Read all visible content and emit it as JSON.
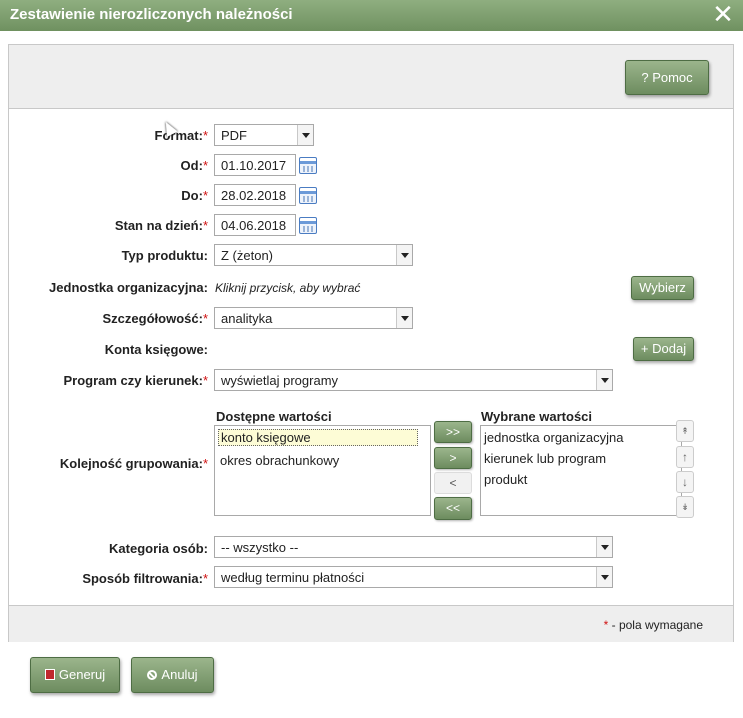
{
  "title": "Zestawienie nierozliczonych należności",
  "toolbar": {
    "help_label": "Pomoc",
    "help_icon": "?"
  },
  "form": {
    "format": {
      "label": "Format:",
      "value": "PDF"
    },
    "od": {
      "label": "Od:",
      "value": "01.10.2017"
    },
    "do": {
      "label": "Do:",
      "value": "28.02.2018"
    },
    "stan": {
      "label": "Stan na dzień:",
      "value": "04.06.2018"
    },
    "typ": {
      "label": "Typ produktu:",
      "value": "Z (żeton)"
    },
    "jednostka": {
      "label": "Jednostka organizacyjna:",
      "hint": "Kliknij przycisk, aby wybrać",
      "button": "Wybierz"
    },
    "szczeg": {
      "label": "Szczegółowość:",
      "value": "analityka"
    },
    "konta": {
      "label": "Konta księgowe:",
      "button": "Dodaj",
      "button_icon": "+"
    },
    "program": {
      "label": "Program czy kierunek:",
      "value": "wyświetlaj programy"
    },
    "grouping": {
      "label": "Kolejność grupowania:",
      "available_header": "Dostępne wartości",
      "selected_header": "Wybrane wartości",
      "available": [
        "konto księgowe",
        "okres obrachunkowy"
      ],
      "selected": [
        "jednostka organizacyjna",
        "kierunek lub program",
        "produkt"
      ],
      "move_buttons": [
        ">>",
        ">",
        "<",
        "<<"
      ],
      "order_buttons": [
        "↟",
        "↑",
        "↓",
        "↡"
      ]
    },
    "kategoria": {
      "label": "Kategoria osób:",
      "value": "-- wszystko --"
    },
    "filtr": {
      "label": "Sposób filtrowania:",
      "value": "według terminu płatności"
    },
    "required_star": "*"
  },
  "footer": {
    "required_note": "- pola wymagane",
    "generate": "Generuj",
    "cancel": "Anuluj"
  },
  "colors": {
    "accent": "#7a9a6b",
    "required": "#d01010"
  }
}
